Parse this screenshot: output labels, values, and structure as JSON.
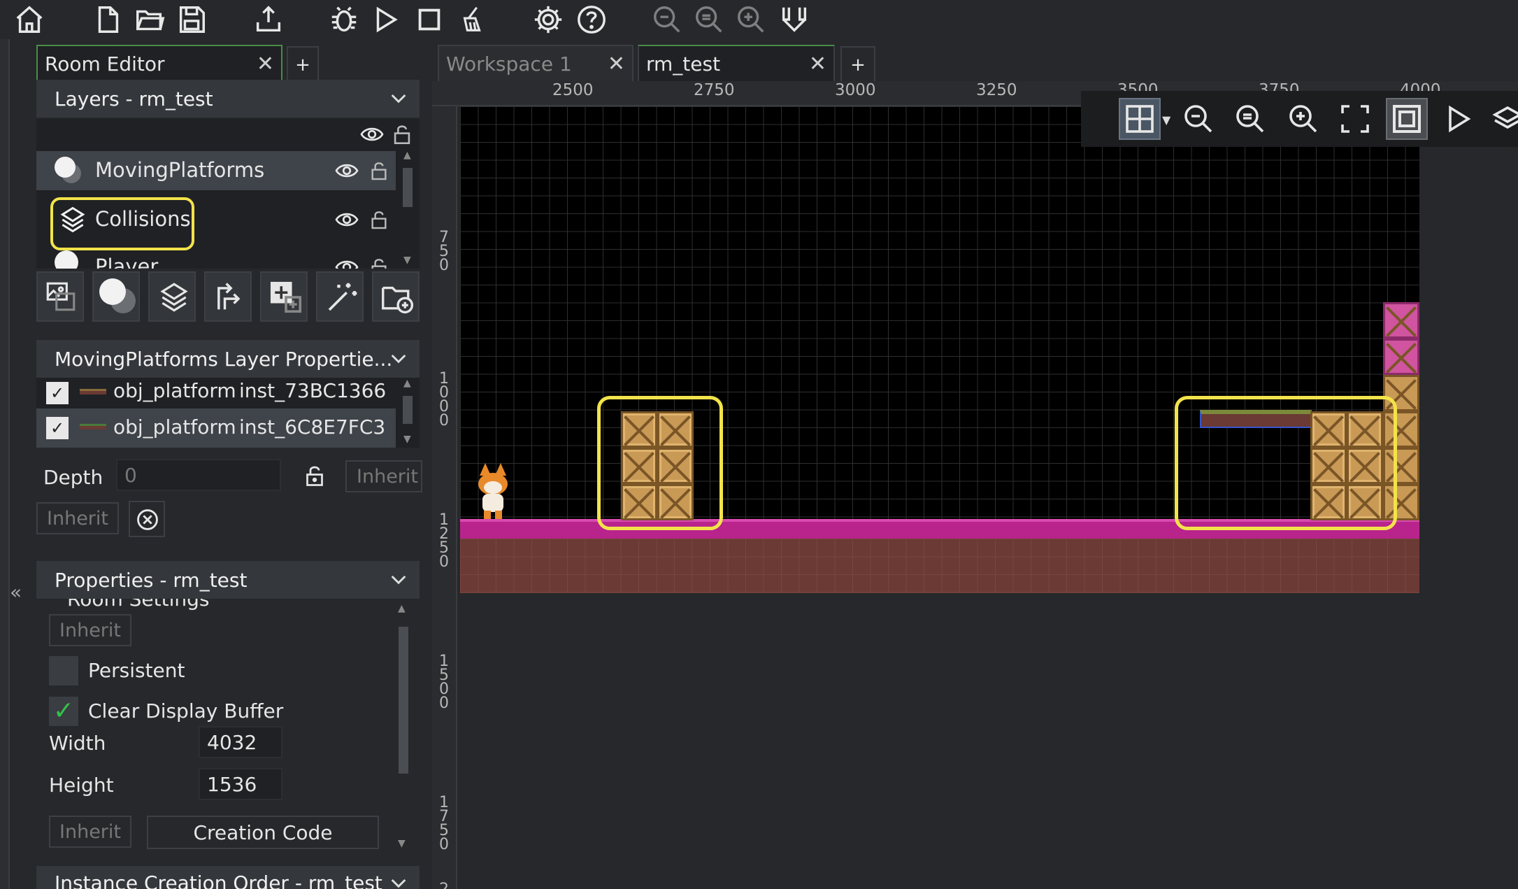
{
  "toolbar": {
    "icons": [
      "home-icon",
      "new-file-icon",
      "open-folder-icon",
      "save-icon",
      "export-icon",
      "debug-icon",
      "run-icon",
      "stop-icon",
      "clean-icon",
      "settings-icon",
      "help-icon",
      "zoom-out-icon",
      "zoom-reset-icon",
      "zoom-in-icon",
      "layout-icon"
    ]
  },
  "left_tabs": {
    "active_label": "Room Editor",
    "add_label": "+"
  },
  "layers_panel": {
    "title": "Layers - rm_test",
    "layers": [
      {
        "name": "MovingPlatforms",
        "type": "instance",
        "selected": true
      },
      {
        "name": "Collisions",
        "type": "tile",
        "highlighted": true
      },
      {
        "name": "Player",
        "type": "instance"
      }
    ]
  },
  "layer_props": {
    "title": "MovingPlatforms Layer Propertie...",
    "instances": [
      {
        "object": "obj_platform",
        "instance": "inst_73BC1366",
        "checked": true
      },
      {
        "object": "obj_platform",
        "instance": "inst_6C8E7FC3",
        "checked": true,
        "selected": true
      }
    ],
    "depth_label": "Depth",
    "depth_value": "0",
    "inherit_label": "Inherit",
    "inherit_label_2": "Inherit"
  },
  "room_props": {
    "title": "Properties - rm_test",
    "section": "Room Settings",
    "inherit_label": "Inherit",
    "persistent_label": "Persistent",
    "persistent_checked": false,
    "clear_display_label": "Clear Display Buffer",
    "clear_display_checked": true,
    "width_label": "Width",
    "width_value": "4032",
    "height_label": "Height",
    "height_value": "1536",
    "inherit_label_2": "Inherit",
    "creation_code_label": "Creation Code"
  },
  "creation_order": {
    "title": "Instance Creation Order - rm_test"
  },
  "doc_tabs": [
    {
      "label": "Workspace 1",
      "active": false
    },
    {
      "label": "rm_test",
      "active": true
    }
  ],
  "doc_add_label": "+",
  "ruler": {
    "h_labels": [
      "2500",
      "2750",
      "3000",
      "3250",
      "3500",
      "3750",
      "4000"
    ],
    "v_labels": [
      "750",
      "1000",
      "1250",
      "1500",
      "1750",
      "2"
    ]
  },
  "colors": {
    "accent_highlight": "#f2e34a",
    "ground": "#b8248c",
    "dirt": "#6b3a34"
  }
}
